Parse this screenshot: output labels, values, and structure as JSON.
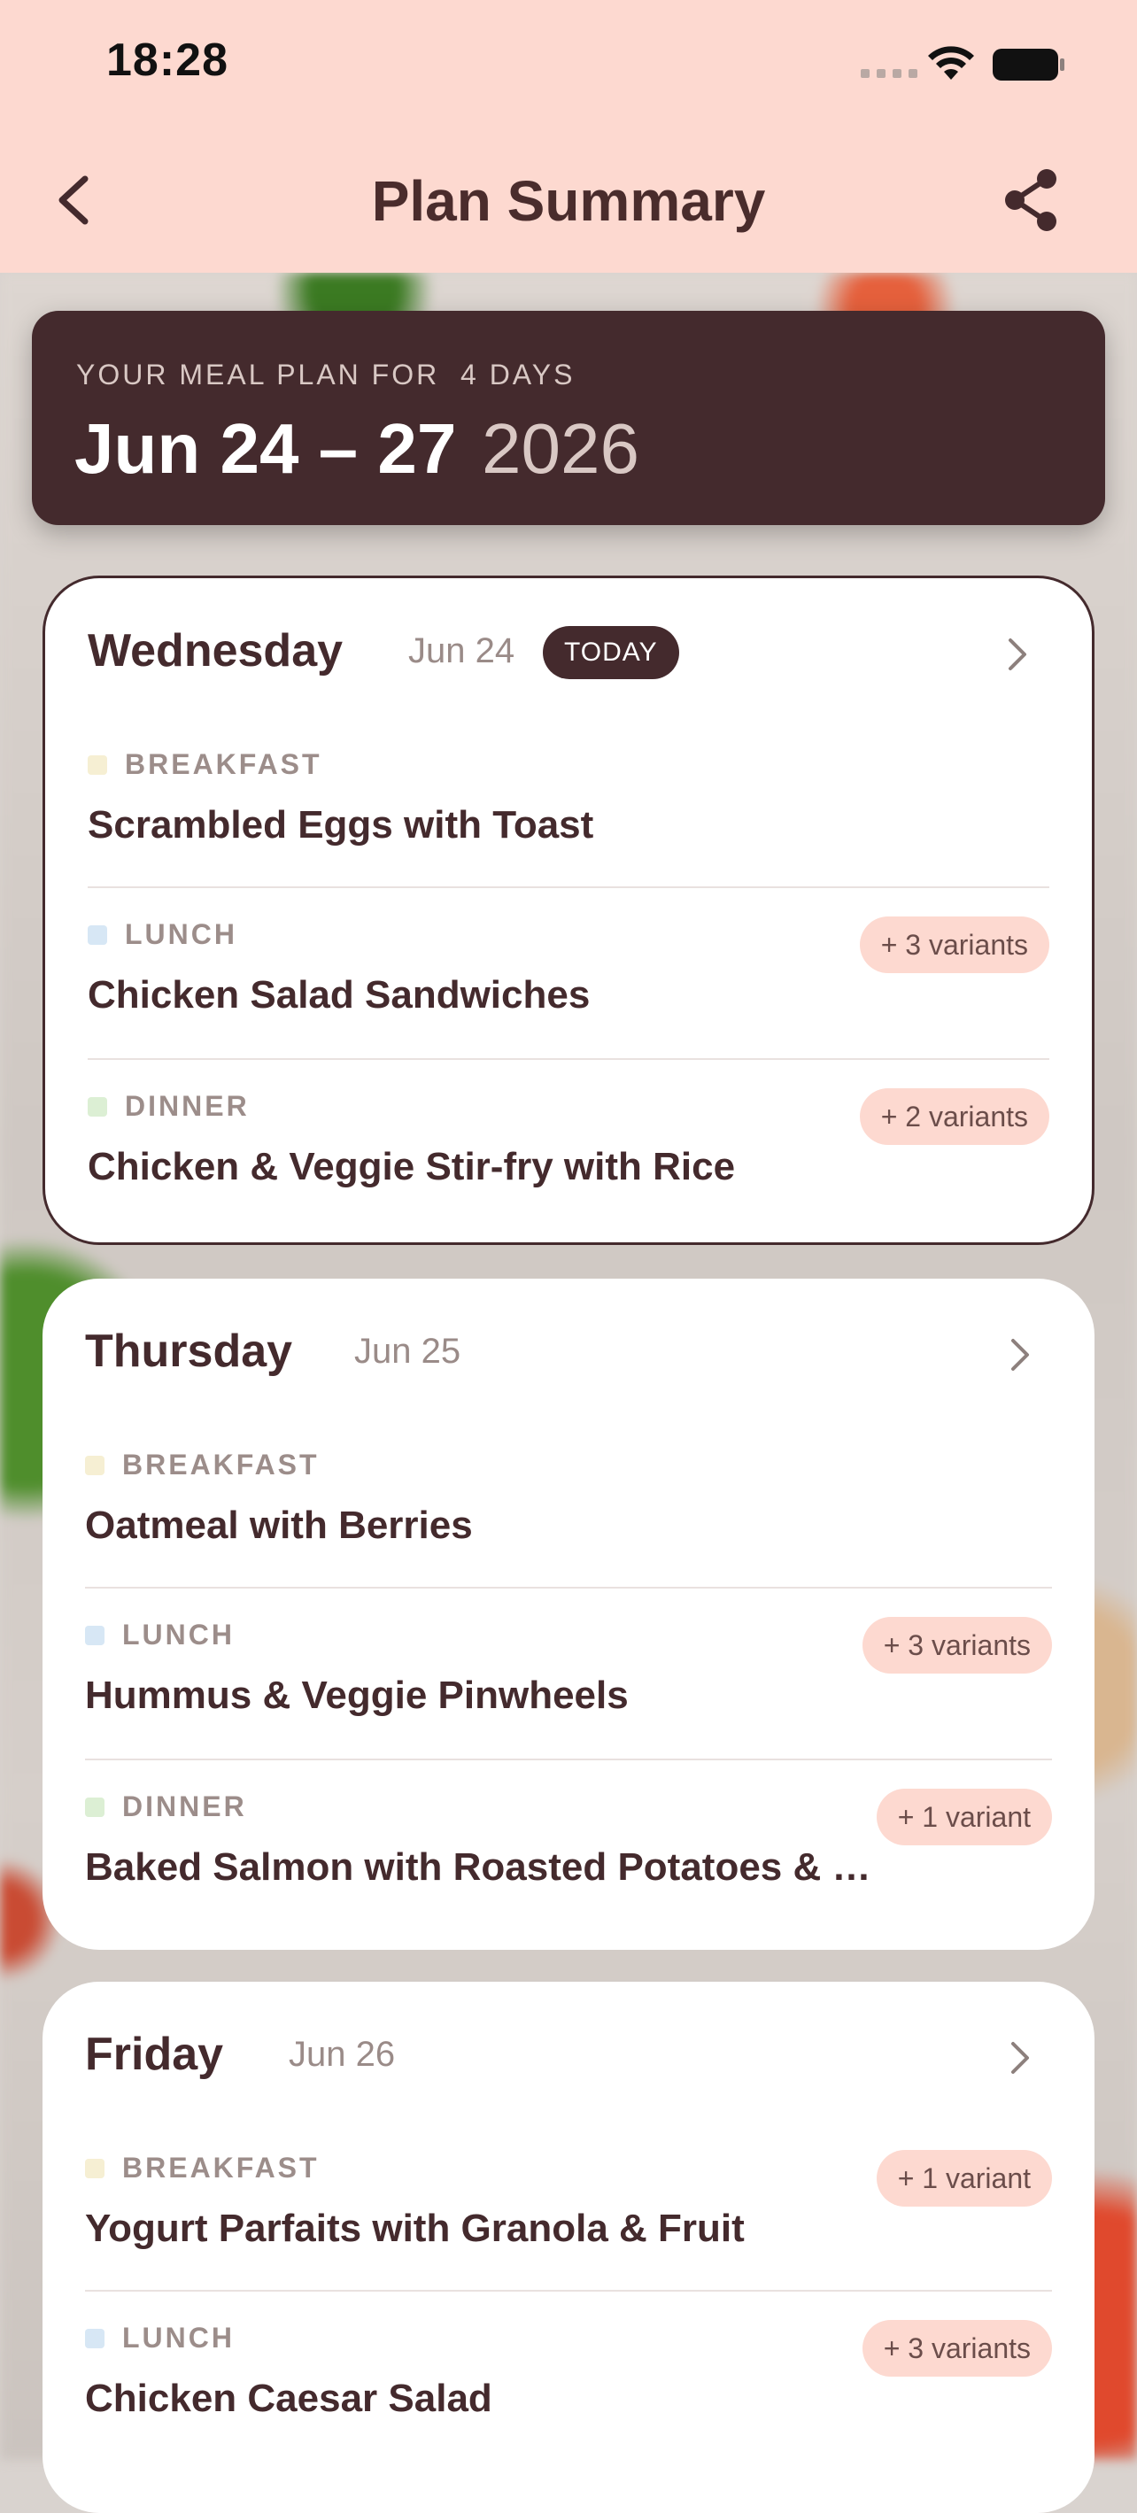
{
  "status": {
    "time": "18:28"
  },
  "nav": {
    "title": "Plan Summary",
    "back_icon": "chevron-left-icon",
    "share_icon": "share-icon"
  },
  "plan": {
    "eyebrow": "YOUR MEAL PLAN FOR  4 DAYS",
    "dates": "Jun 24 – 27",
    "year": "2026"
  },
  "days": [
    {
      "name": "Wednesday",
      "date": "Jun 24",
      "badge": "TODAY",
      "meals": [
        {
          "type": "BREAKFAST",
          "name": "Scrambled Eggs with Toast",
          "variants": ""
        },
        {
          "type": "LUNCH",
          "name": "Chicken Salad Sandwiches",
          "variants": "+ 3 variants"
        },
        {
          "type": "DINNER",
          "name": "Chicken & Veggie Stir-fry with Rice",
          "variants": "+ 2 variants"
        }
      ]
    },
    {
      "name": "Thursday",
      "date": "Jun 25",
      "badge": "",
      "meals": [
        {
          "type": "BREAKFAST",
          "name": "Oatmeal with Berries",
          "variants": ""
        },
        {
          "type": "LUNCH",
          "name": "Hummus & Veggie Pinwheels",
          "variants": "+ 3 variants"
        },
        {
          "type": "DINNER",
          "name": "Baked Salmon with Roasted Potatoes & …",
          "variants": "+ 1 variant"
        }
      ]
    },
    {
      "name": "Friday",
      "date": "Jun 26",
      "badge": "",
      "meals": [
        {
          "type": "BREAKFAST",
          "name": "Yogurt Parfaits with Granola & Fruit",
          "variants": "+ 1 variant"
        },
        {
          "type": "LUNCH",
          "name": "Chicken Caesar Salad",
          "variants": "+ 3 variants"
        }
      ]
    }
  ]
}
